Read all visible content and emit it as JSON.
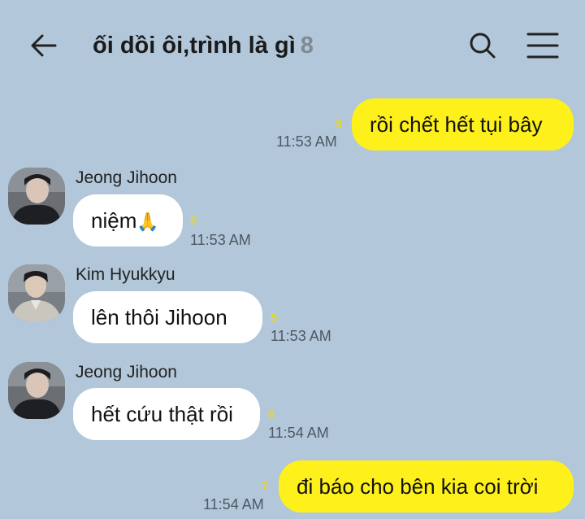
{
  "header": {
    "title": "ối dồi ôi,trình là gì",
    "member_count": "8"
  },
  "messages": [
    {
      "direction": "out",
      "text": "rồi chết hết tụi bây",
      "unread": "5",
      "time": "11:53 AM"
    },
    {
      "direction": "in",
      "sender": "Jeong Jihoon",
      "text": "niệm",
      "emoji": "🙏",
      "unread": "5",
      "time": "11:53 AM"
    },
    {
      "direction": "in",
      "sender": "Kim Hyukkyu",
      "text": "lên thôi Jihoon",
      "unread": "5",
      "time": "11:53 AM"
    },
    {
      "direction": "in",
      "sender": "Jeong Jihoon",
      "text": "hết cứu thật rồi",
      "unread": "6",
      "time": "11:54 AM"
    },
    {
      "direction": "out",
      "text": "đi báo cho bên kia coi trời",
      "unread": "7",
      "time": "11:54 AM"
    }
  ],
  "icons": {
    "back": "arrow-left-icon",
    "search": "search-icon",
    "menu": "hamburger-menu-icon"
  },
  "colors": {
    "background": "#b2c7d9",
    "outgoing_bubble": "#fef01b",
    "incoming_bubble": "#ffffff",
    "unread_count": "#e7d631"
  }
}
